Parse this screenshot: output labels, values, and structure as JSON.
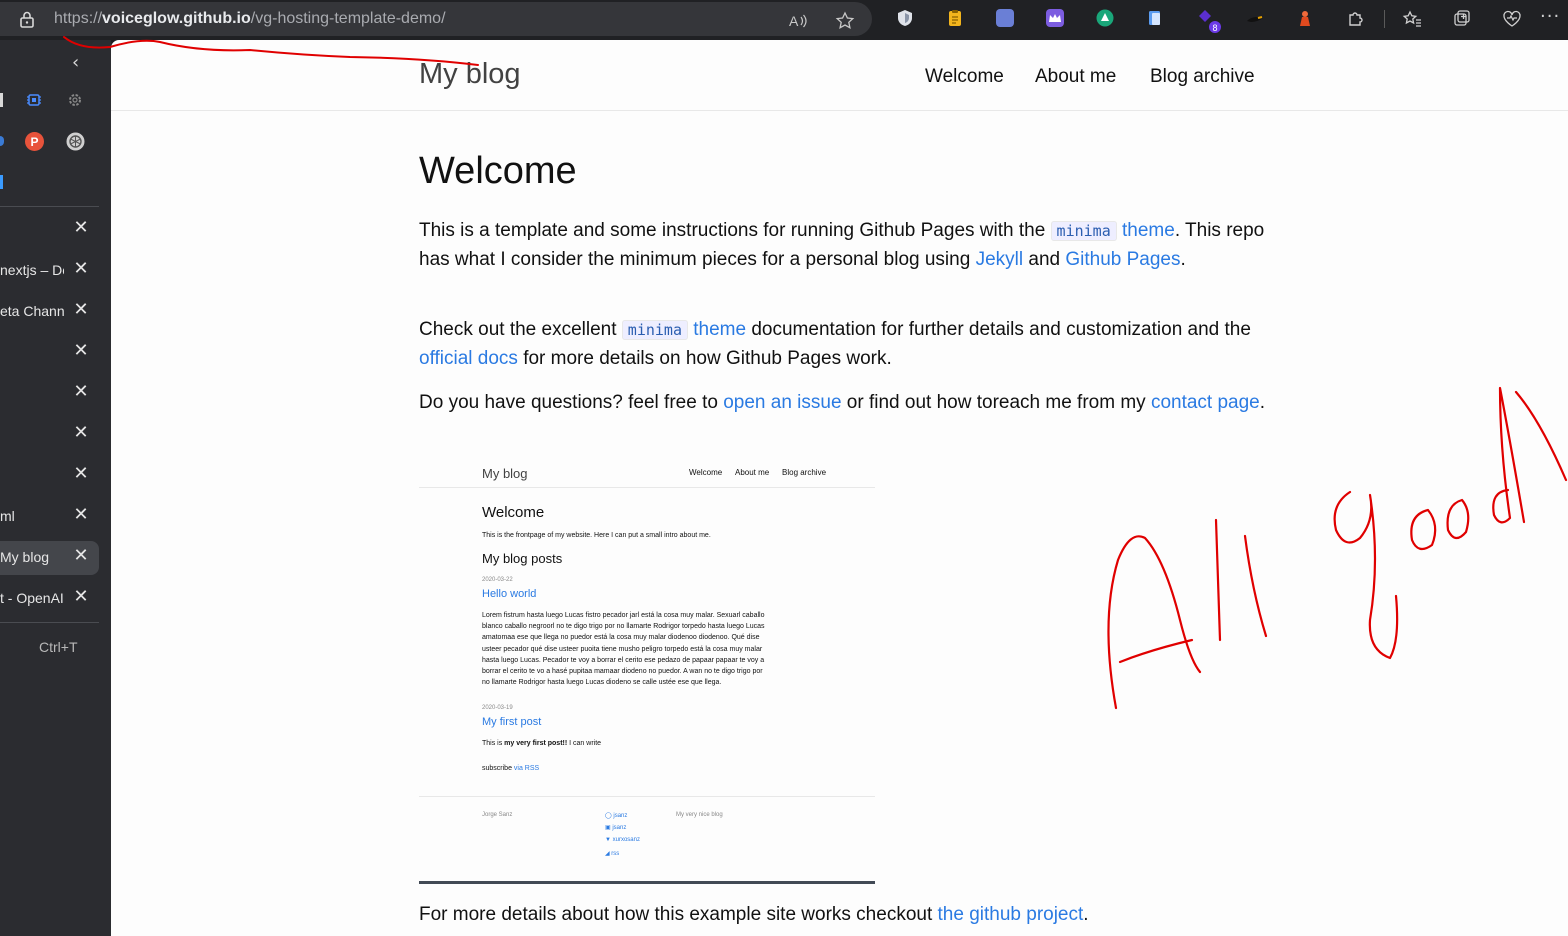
{
  "browser": {
    "url_scheme": "https://",
    "url_host": "voiceglow.github.io",
    "url_path": "/vg-hosting-template-demo/",
    "extension_badge_count": "8"
  },
  "sidebar": {
    "tabs": [
      {
        "label": ""
      },
      {
        "label": "nextjs – De"
      },
      {
        "label": "eta Channe"
      },
      {
        "label": ""
      },
      {
        "label": ""
      },
      {
        "label": ""
      },
      {
        "label": ""
      },
      {
        "label": "ml"
      },
      {
        "label": "My blog"
      },
      {
        "label": "t - OpenAI"
      }
    ],
    "new_tab_shortcut": "Ctrl+T"
  },
  "site": {
    "title": "My blog",
    "nav": [
      "Welcome",
      "About me",
      "Blog archive"
    ]
  },
  "content": {
    "heading": "Welcome",
    "p1": {
      "t1": "This is a template and some instructions for running Github Pages with the ",
      "code1": "minima",
      "link1": "theme",
      "t2": ". This repo has what I consider the minimum pieces for a personal blog using ",
      "link2": "Jekyll",
      "t3": " and ",
      "link3": "Github Pages",
      "t4": "."
    },
    "p2": {
      "t1": "Check out the excellent ",
      "code1": "minima",
      "link1": "theme",
      "t2": " documentation for further details and customization and the ",
      "link2": "official docs",
      "t3": " for more details on how Github Pages work."
    },
    "p3": {
      "t1": "Do you have questions? feel free to ",
      "link1": "open an issue",
      "t2": " or find out how toreach me from my ",
      "link2": "contact page",
      "t3": "."
    },
    "p4": {
      "t1": "For more details about how this example site works checkout ",
      "link1": "the github project",
      "t2": "."
    }
  },
  "screenshot": {
    "site_title": "My blog",
    "nav": [
      "Welcome",
      "About me",
      "Blog archive"
    ],
    "heading": "Welcome",
    "intro": "This is the frontpage of my website. Here I can put a small intro about me.",
    "posts_heading": "My blog posts",
    "post1_date": "2020-03-22",
    "post1_title": "Hello world",
    "post1_excerpt": [
      "Lorem fistrum hasta luego Lucas fistro pecador jarl está la cosa muy malar. Sexuarl caballo",
      "blanco caballo negroorl no te digo trigo por no llamarte Rodrigor torpedo hasta luego Lucas",
      "amatomaa ese que llega no puedor está la cosa muy malar diodenoo diodenoo. Qué dise",
      "usteer pecador qué dise usteer puoita tiene musho peligro torpedo está la cosa muy malar",
      "hasta luego Lucas. Pecador te voy a borrar el cerito ese pedazo de papaar papaar te voy a",
      "borrar el cerito te vo a hasé pupitaa mamaar diodeno no puedor. A wan no te digo trigo por",
      "no llamarte Rodrigor hasta luego Lucas diodeno se calle ustée ese que llega."
    ],
    "post2_date": "2020-03-19",
    "post2_title": "My first post",
    "post2_excerpt_a": "This is ",
    "post2_excerpt_b": "my very first post!!",
    "post2_excerpt_c": " I can write",
    "subscribe": "subscribe ",
    "subscribe_link": "via RSS",
    "footer_name": "Jorge Sanz",
    "footer_links": [
      "jsanz",
      "jsanz",
      "xurxosanz",
      "rss"
    ],
    "footer_desc": "My very nice blog"
  },
  "annotation": {
    "text": "All good",
    "color": "#e00000"
  }
}
